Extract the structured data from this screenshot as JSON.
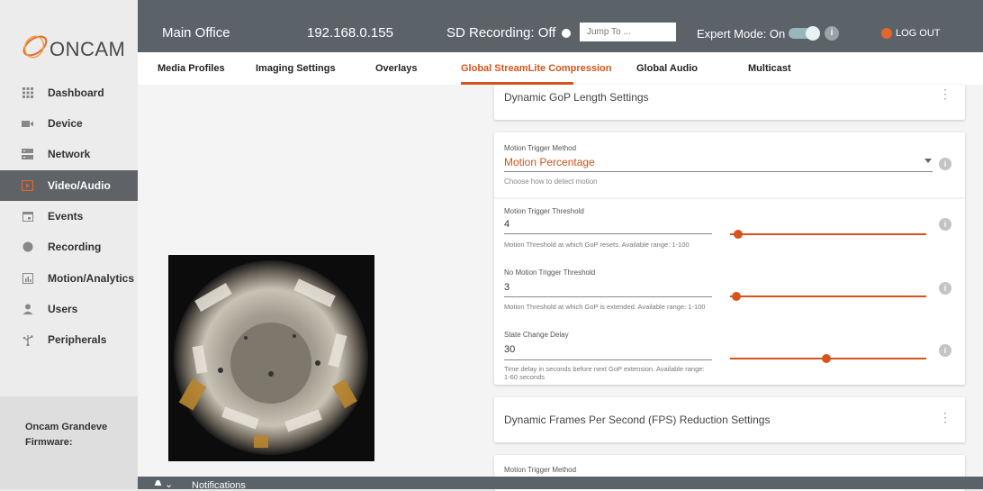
{
  "brand": {
    "name": "ONCAM"
  },
  "sidebar": {
    "items": [
      {
        "label": "Dashboard",
        "icon": "grid-icon"
      },
      {
        "label": "Device",
        "icon": "camera-icon"
      },
      {
        "label": "Network",
        "icon": "network-icon"
      },
      {
        "label": "Video/Audio",
        "icon": "video-icon",
        "active": true
      },
      {
        "label": "Events",
        "icon": "calendar-icon"
      },
      {
        "label": "Recording",
        "icon": "record-icon"
      },
      {
        "label": "Motion/Analytics",
        "icon": "chart-icon"
      },
      {
        "label": "Users",
        "icon": "user-icon"
      },
      {
        "label": "Peripherals",
        "icon": "usb-icon"
      }
    ],
    "firmware": {
      "device_label": "Oncam Grandeve",
      "firmware_label": "Firmware:"
    }
  },
  "header": {
    "location": "Main Office",
    "ip": "192.168.0.155",
    "sd_recording": "SD Recording: Off",
    "jump_placeholder": "Jump To ...",
    "expert_mode": "Expert Mode: On",
    "logout": "LOG OUT"
  },
  "tabs": [
    {
      "label": "Media Profiles"
    },
    {
      "label": "Imaging Settings"
    },
    {
      "label": "Overlays"
    },
    {
      "label": "Global StreamLite Compression",
      "active": true
    },
    {
      "label": "Global Audio"
    },
    {
      "label": "Multicast"
    }
  ],
  "sections": {
    "gop": {
      "title": "Dynamic GoP Length Settings",
      "trigger_method_label": "Motion Trigger Method",
      "trigger_method_value": "Motion Percentage",
      "trigger_method_help": "Choose how to detect motion",
      "fields": [
        {
          "label": "Motion Trigger Threshold",
          "value": "4",
          "help": "Motion Threshold at which GoP resets. Available range: 1-100",
          "slider_level": 0.04
        },
        {
          "label": "No Motion Trigger Threshold",
          "value": "3",
          "help": "Motion Threshold at which GoP is extended. Available range: 1-100",
          "slider_level": 0.03
        },
        {
          "label": "State Change Delay",
          "value": "30",
          "help": "Time delay in seconds before next GoP extension. Available range: 1-60 seconds",
          "slider_level": 0.49
        }
      ]
    },
    "fps": {
      "title": "Dynamic Frames Per Second (FPS) Reduction Settings",
      "trigger_method_label": "Motion Trigger Method"
    }
  },
  "footer": {
    "notifications": "Notifications"
  },
  "colors": {
    "accent": "#d6541b",
    "header_bg": "#5b6369",
    "sidebar_active": "#5f6368"
  }
}
